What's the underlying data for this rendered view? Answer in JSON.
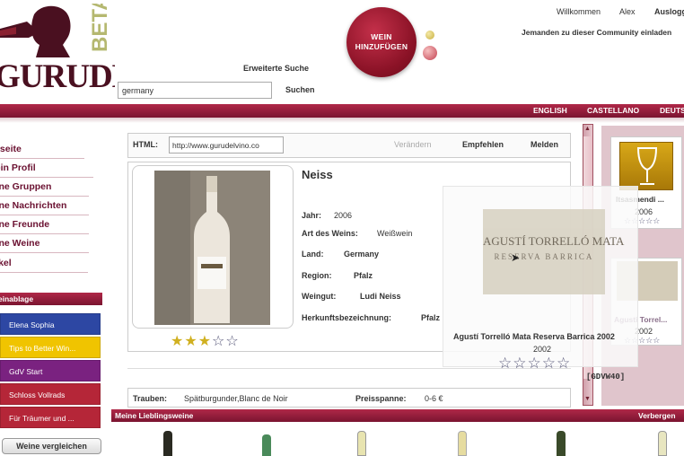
{
  "header": {
    "logo_text": "GURUDELVINO",
    "logo_beta": "BETA",
    "advanced_search": "Erweiterte Suche",
    "search_value": "germany",
    "search_button": "Suchen",
    "add_wine_line1": "WEIN",
    "add_wine_line2": "HINZUFÜGEN",
    "welcome": "Willkommen",
    "user": "Alex",
    "logout": "Ausloggen",
    "invite": "Jemanden zu dieser Community einladen"
  },
  "languages": [
    "ENGLISH",
    "CASTELLANO",
    "DEUTSCH"
  ],
  "nav": [
    "Startseite",
    "Mein Profil",
    "Meine Gruppen",
    "Meine Nachrichten",
    "Meine Freunde",
    "Meine Weine",
    "Artikel"
  ],
  "clipboard": {
    "header": "Weinablage",
    "items": [
      {
        "label": "Elena Sophia",
        "color": "#2d47a3"
      },
      {
        "label": "Tips to Better Win...",
        "color": "#f0c400"
      },
      {
        "label": "GdV Start",
        "color": "#7a2280"
      },
      {
        "label": "Schloss Vollrads",
        "color": "#b52638"
      },
      {
        "label": "Für Träumer und ...",
        "color": "#b52638"
      }
    ],
    "compare_button": "Weine vergleichen"
  },
  "share": {
    "label": "HTML:",
    "url": "http://www.gurudelvino.co",
    "actions": [
      "Verändern",
      "Empfehlen",
      "Melden"
    ]
  },
  "wine": {
    "name": "Neiss",
    "rating_stars": 3,
    "rating_max": 5,
    "fields": [
      {
        "label": "Jahr:",
        "value": "2006"
      },
      {
        "label": "Art des Weins:",
        "value": "Weißwein"
      },
      {
        "label": "Land:",
        "value": "Germany"
      },
      {
        "label": "Region:",
        "value": "Pfalz"
      },
      {
        "label": "Weingut:",
        "value": "Ludi Neiss"
      },
      {
        "label": "Herkunftsbezeichnung:",
        "value": "Pfalz"
      }
    ],
    "grapes_label": "Trauben:",
    "grapes_value": "Spätburgunder,Blanc de Noir",
    "price_label": "Preisspanne:",
    "price_value": "0-6 €"
  },
  "popup": {
    "label_text": "AGUSTÍ TORRELLÓ MATA",
    "label_sub": "RESERVA BARRICA",
    "title": "Agustí Torrelló Mata Reserva Barrica 2002",
    "year": "2002",
    "code": "[GDVW40]"
  },
  "right_cards": [
    {
      "title": "Itsasmendi ...",
      "year": "2006"
    },
    {
      "title": "Agusti Torrel...",
      "year": "2002"
    }
  ],
  "favorites": {
    "label": "Meine Lieblingsweine",
    "right_label": "Verbergen"
  },
  "colors": {
    "brand": "#8a1430",
    "accent_gold": "#c89a10"
  }
}
